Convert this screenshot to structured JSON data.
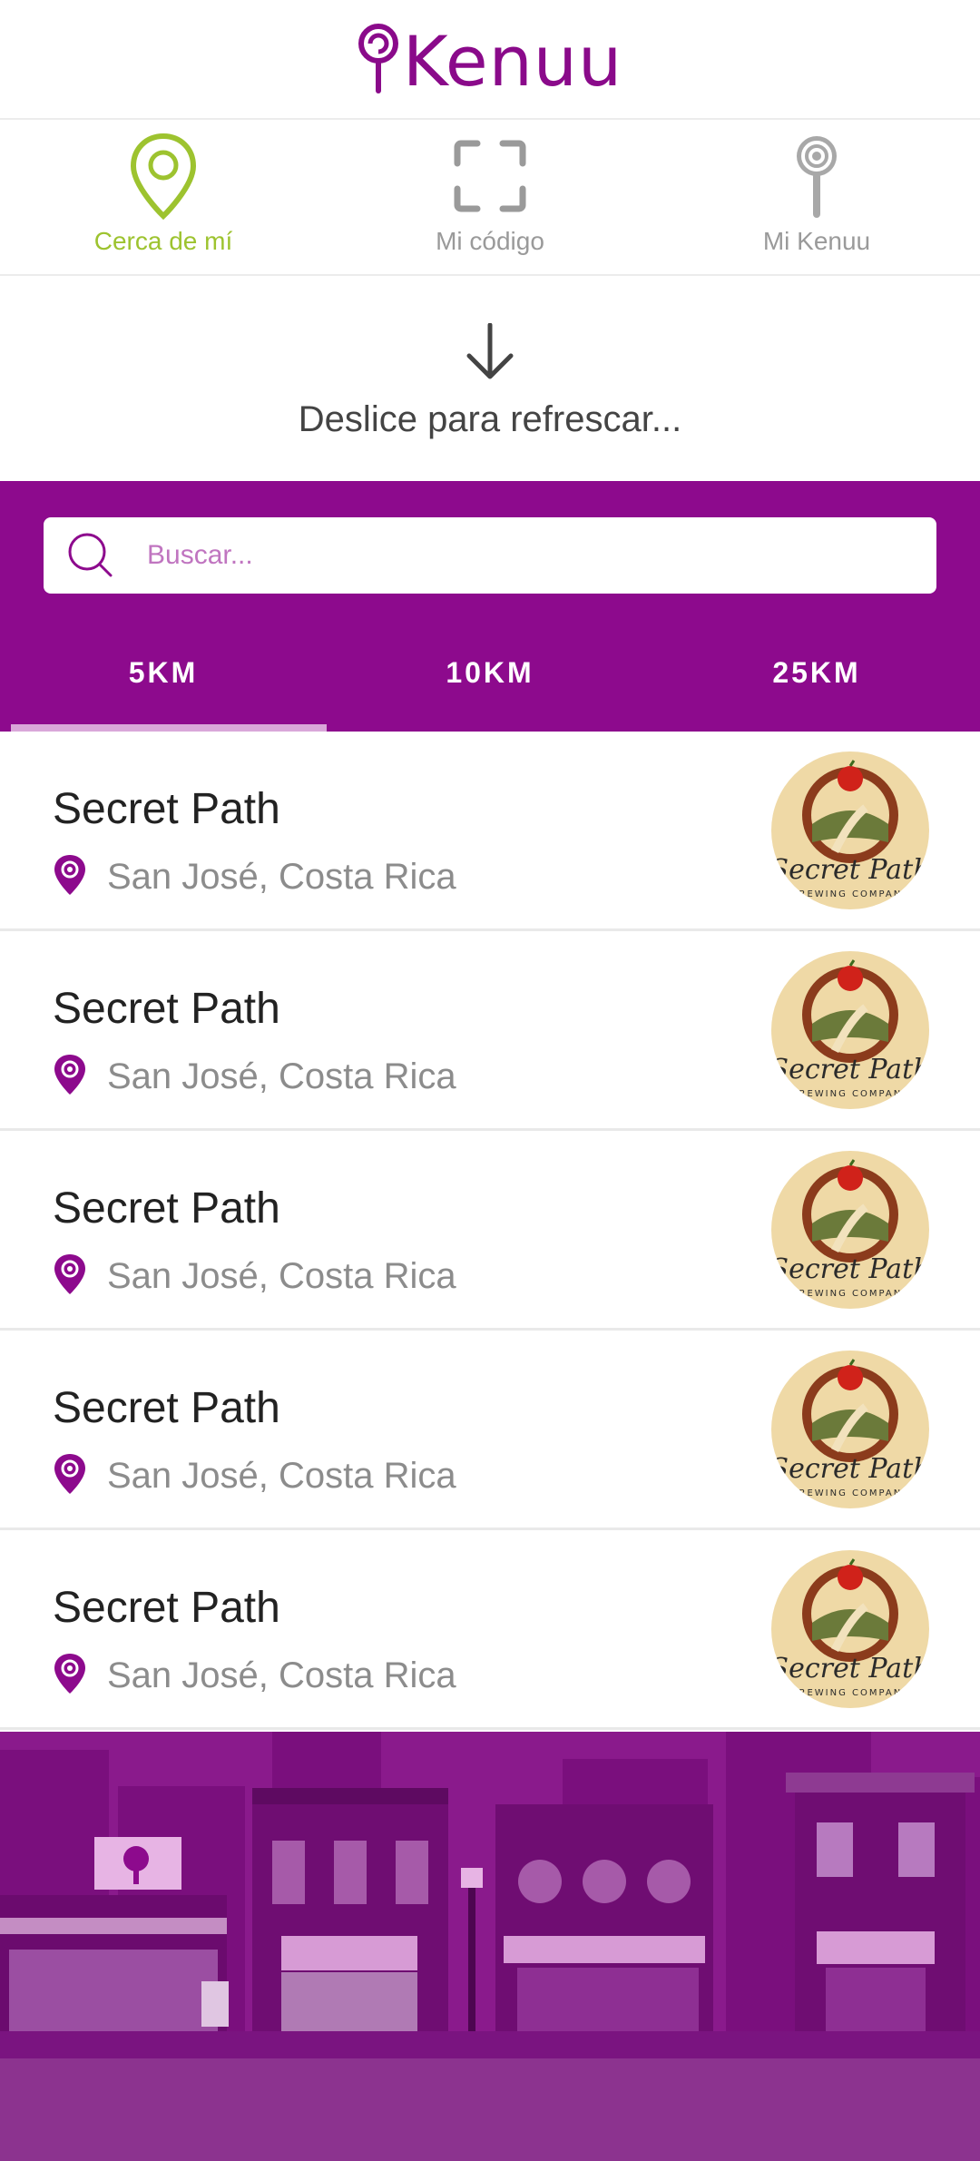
{
  "app": {
    "name": "Kenuu"
  },
  "nav": {
    "items": [
      {
        "label": "Cerca de mí",
        "icon": "map-pin-icon",
        "active": true
      },
      {
        "label": "Mi código",
        "icon": "scan-frame-icon",
        "active": false
      },
      {
        "label": "Mi Kenuu",
        "icon": "lollipop-icon",
        "active": false
      }
    ]
  },
  "refresh": {
    "text": "Deslice para refrescar..."
  },
  "search": {
    "placeholder": "Buscar..."
  },
  "tabs": [
    {
      "label": "5KM",
      "active": true
    },
    {
      "label": "10KM",
      "active": false
    },
    {
      "label": "25KM",
      "active": false
    }
  ],
  "list": {
    "items": [
      {
        "title": "Secret Path",
        "location": "San José, Costa Rica",
        "logo": "secret-path-logo"
      },
      {
        "title": "Secret Path",
        "location": "San José, Costa Rica",
        "logo": "secret-path-logo"
      },
      {
        "title": "Secret Path",
        "location": "San José, Costa Rica",
        "logo": "secret-path-logo"
      },
      {
        "title": "Secret Path",
        "location": "San José, Costa Rica",
        "logo": "secret-path-logo"
      },
      {
        "title": "Secret Path",
        "location": "San José, Costa Rica",
        "logo": "secret-path-logo"
      }
    ]
  },
  "colors": {
    "brand": "#8d0a8d",
    "active_nav": "#9dc32f",
    "inactive_nav": "#9a9a9a",
    "logo_bg": "#efd9a6"
  }
}
